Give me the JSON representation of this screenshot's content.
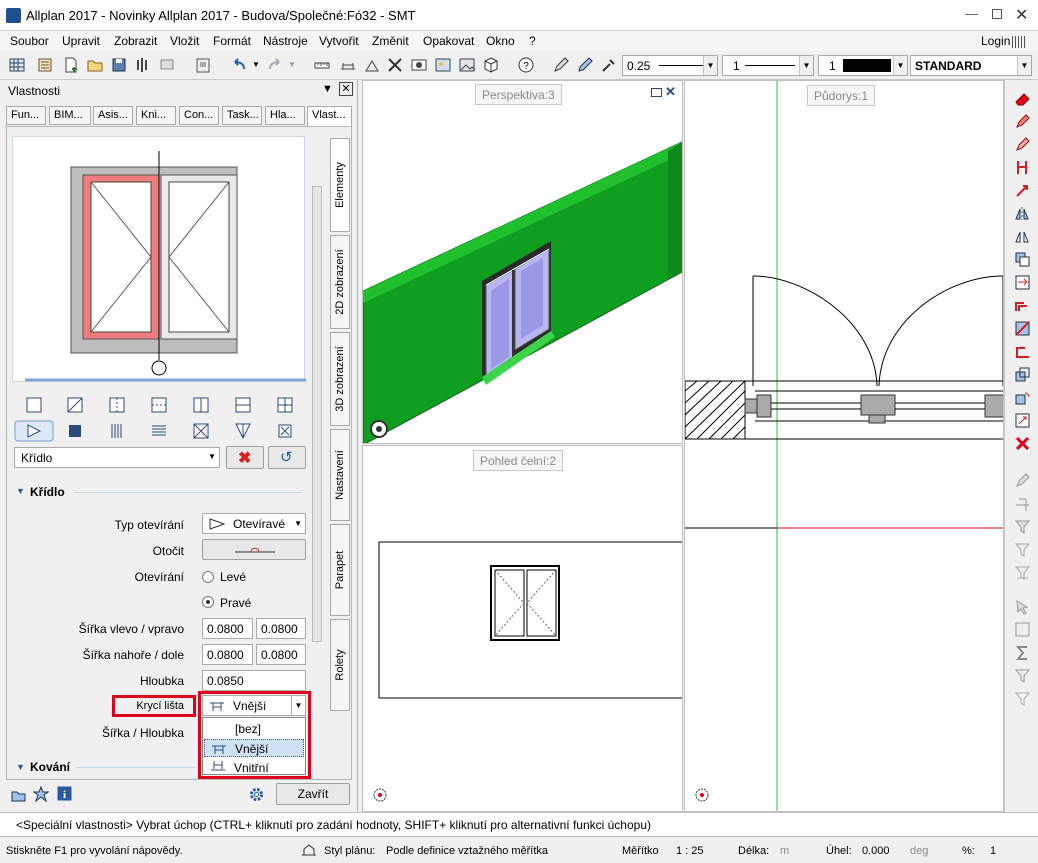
{
  "app": {
    "title": "Allplan 2017 - Novinky Allplan 2017 - Budova/Společné:Fó32 - SMT",
    "login": "Login"
  },
  "menu": [
    "Soubor",
    "Upravit",
    "Zobrazit",
    "Vložit",
    "Formát",
    "Nástroje",
    "Vytvořit",
    "Změnit",
    "Opakovat",
    "Okno",
    "?"
  ],
  "toolbar": {
    "pen_value": "0.25",
    "line_value": "1",
    "color_value": "1",
    "layer_value": "STANDARD"
  },
  "panel": {
    "title": "Vlastnosti",
    "tabs": [
      "Fun...",
      "BIM...",
      "Asis...",
      "Kni...",
      "Con...",
      "Task...",
      "Hla...",
      "Vlast..."
    ],
    "vtabs": [
      "Elementy",
      "2D zobrazení",
      "3D zobrazení",
      "Nastavení",
      "Parapet",
      "Rolety"
    ],
    "element_select": "Křídlo",
    "section_title": "Křídlo",
    "section2_title": "Kování",
    "labels": {
      "typ_otevirani": "Typ otevírání",
      "otocit": "Otočit",
      "otevirani": "Otevírání",
      "sirka_vlevo": "Šířka vlevo / vpravo",
      "sirka_nahore": "Šířka nahoře / dole",
      "hloubka": "Hloubka",
      "kryci_lista": "Krycí lišta",
      "sirka_hloubka": "Šířka / Hloubka"
    },
    "values": {
      "typ_otevirani": "Otevíravé",
      "otevirani_left": "Levé",
      "otevirani_right": "Pravé",
      "otevirani_selected": "Pravé",
      "sirka_vlevo": "0.0800",
      "sirka_vpravo": "0.0800",
      "sirka_nahore": "0.0800",
      "sirka_dole": "0.0800",
      "hloubka": "0.0850",
      "kryci_lista": "Vnější"
    },
    "dropdown_options": [
      "[bez]",
      "Vnější",
      "Vnitřní"
    ],
    "dropdown_selected": "Vnější",
    "close_button": "Zavřít"
  },
  "viewports": {
    "perspective": "Perspektiva:3",
    "front": "Pohled čelní:2",
    "plan": "Půdorys:1"
  },
  "command_line": "<Speciální vlastnosti> Vybrat úchop (CTRL+ kliknutí pro zadání hodnoty, SHIFT+ kliknutí pro alternativní funkci úchopu)",
  "status": {
    "help": "Stiskněte F1 pro vyvolání nápovědy.",
    "plan_style_label": "Styl plánu:",
    "plan_style_value": "Podle definice vztažného měřítka",
    "scale_label": "Měřítko",
    "scale_value": "1 : 25",
    "length_label": "Délka:",
    "length_unit": "m",
    "angle_label": "Úhel:",
    "angle_value": "0.000",
    "angle_unit": "deg",
    "percent_label": "%:",
    "percent_value": "1"
  },
  "colors": {
    "accent_red": "#e0001b",
    "wall_green": "#0f9e1f",
    "sash_highlight": "#f07d7d"
  }
}
